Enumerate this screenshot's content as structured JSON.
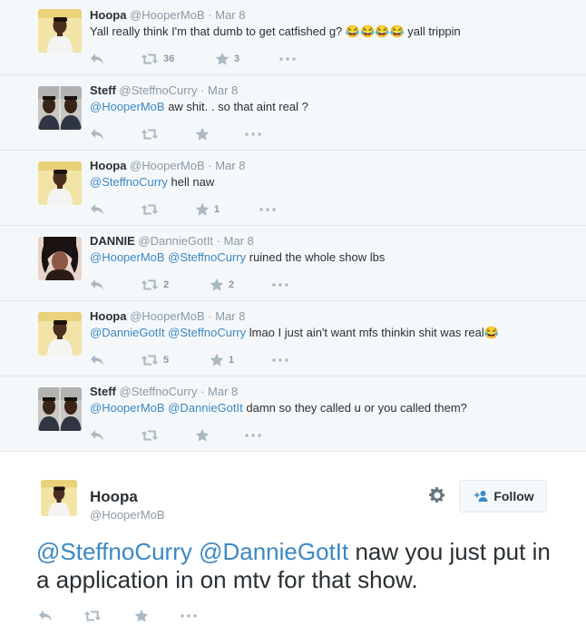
{
  "replies": [
    {
      "name": "Hoopa",
      "handle": "@HooperMoB",
      "dot": "·",
      "time": "Mar 8",
      "mentions": "",
      "text": "Yall really think I'm that dumb to get catfished g? 😂😂😂😂 yall trippin",
      "retweets": "36",
      "favorites": "3",
      "avatar": "hoopa-avatar"
    },
    {
      "name": "Steff",
      "handle": "@SteffnoCurry",
      "dot": "·",
      "time": "Mar 8",
      "mentions": "@HooperMoB",
      "text": " aw shit. . so that aint real ?",
      "retweets": "",
      "favorites": "",
      "avatar": "steff-avatar"
    },
    {
      "name": "Hoopa",
      "handle": "@HooperMoB",
      "dot": "·",
      "time": "Mar 8",
      "mentions": "@SteffnoCurry",
      "text": " hell naw",
      "retweets": "",
      "favorites": "1",
      "avatar": "hoopa-avatar"
    },
    {
      "name": "DANNIE",
      "handle": "@DannieGotIt",
      "dot": "·",
      "time": "Mar 8",
      "mentions": "@HooperMoB @SteffnoCurry",
      "text": " ruined the whole show lbs",
      "retweets": "2",
      "favorites": "2",
      "avatar": "dannie-avatar"
    },
    {
      "name": "Hoopa",
      "handle": "@HooperMoB",
      "dot": "·",
      "time": "Mar 8",
      "mentions": "@DannieGotIt @SteffnoCurry",
      "text": " lmao I just ain't want mfs thinkin shit was real😂",
      "retweets": "5",
      "favorites": "1",
      "avatar": "hoopa-avatar"
    },
    {
      "name": "Steff",
      "handle": "@SteffnoCurry",
      "dot": "·",
      "time": "Mar 8",
      "mentions": "@HooperMoB @DannieGotIt",
      "text": " damn so they called u or you called them?",
      "retweets": "",
      "favorites": "",
      "avatar": "steff-avatar"
    }
  ],
  "main_tweet": {
    "name": "Hoopa",
    "handle": "@HooperMoB",
    "follow_label": "Follow",
    "mentions": "@SteffnoCurry @DannieGotIt",
    "text": " naw you just put in a application in on mtv for that show."
  },
  "colors": {
    "link": "#3b88c3",
    "icon": "#aab8c2",
    "thread_bg": "#f5f8fa",
    "border": "#e1e8ed"
  }
}
